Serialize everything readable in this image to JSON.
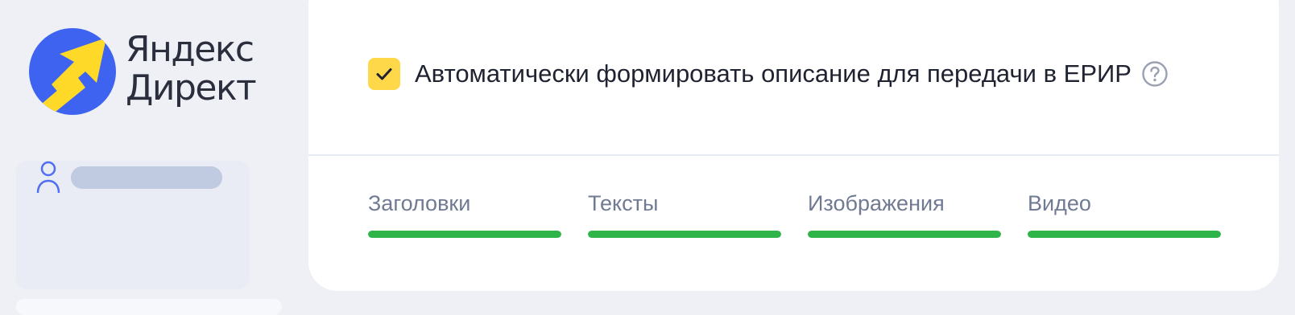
{
  "logo": {
    "line1": "Яндекс",
    "line2": "Директ",
    "colors": {
      "circle": "#3d63f0",
      "arrow": "#ffd928"
    }
  },
  "user": {
    "icon": "user-icon",
    "name_hidden": true
  },
  "settings": {
    "auto_erir_description": {
      "checked": true,
      "label": "Автоматически формировать описание для передачи в ЕРИР",
      "help_icon": "question-circle-icon"
    }
  },
  "tabs": [
    {
      "label": "Заголовки",
      "progress": 1.0
    },
    {
      "label": "Тексты",
      "progress": 1.0
    },
    {
      "label": "Изображения",
      "progress": 1.0
    },
    {
      "label": "Видео",
      "progress": 1.0
    }
  ],
  "colors": {
    "checkbox": "#ffd84a",
    "progress": "#2fb44a",
    "background": "#eef0f6",
    "card": "#ffffff"
  }
}
